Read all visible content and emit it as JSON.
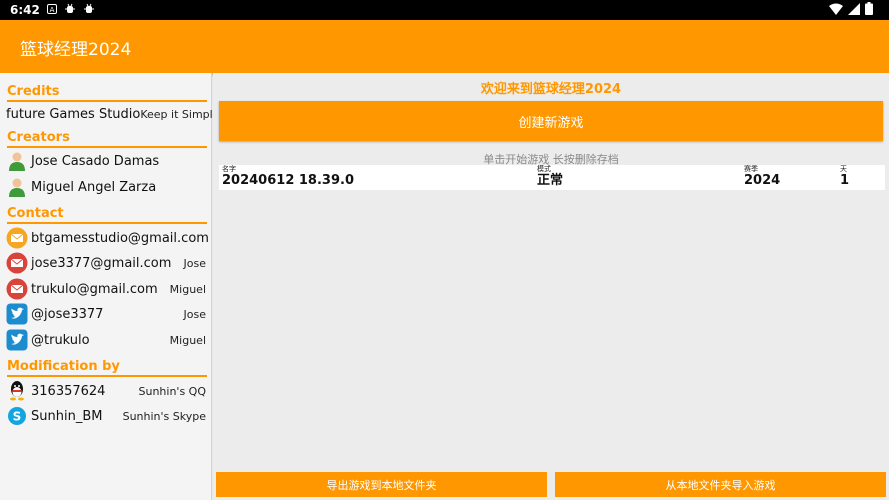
{
  "status_bar": {
    "time": "6:42",
    "icons": [
      "a-icon",
      "bug-icon",
      "bug-icon"
    ],
    "right_icons": [
      "wifi-icon",
      "signal-icon",
      "battery-icon"
    ]
  },
  "app_bar": {
    "title": "篮球经理2024"
  },
  "credits": {
    "header": "Credits",
    "studio": "future Games Studio",
    "slogan": "Keep it Simple"
  },
  "creators": {
    "header": "Creators",
    "people": [
      {
        "name": "Jose Casado Damas",
        "icon": "person-icon"
      },
      {
        "name": "Miguel Angel Zarza",
        "icon": "person-icon"
      }
    ]
  },
  "contact": {
    "header": "Contact",
    "items": [
      {
        "text": "btgamesstudio@gmail.com",
        "who": "",
        "icon": "mail-icon"
      },
      {
        "text": "jose3377@gmail.com",
        "who": "Jose",
        "icon": "mail-icon"
      },
      {
        "text": "trukulo@gmail.com",
        "who": "Miguel",
        "icon": "mail-icon"
      },
      {
        "text": "@jose3377",
        "who": "Jose",
        "icon": "twitter-icon"
      },
      {
        "text": "@trukulo",
        "who": "Miguel",
        "icon": "twitter-icon"
      }
    ]
  },
  "modification": {
    "header": "Modification by",
    "items": [
      {
        "text": "316357624",
        "who": "Sunhin's QQ",
        "icon": "qq-icon"
      },
      {
        "text": "Sunhin_BM",
        "who": "Sunhin's Skype",
        "icon": "skype-icon"
      }
    ]
  },
  "main": {
    "welcome": "欢迎来到篮球经理2024",
    "new_game_label": "创建新游戏",
    "hint": "单击开始游戏 长按删除存档",
    "save_slot": {
      "name_label": "名字",
      "name_value": "20240612 18.39.0",
      "mode_label": "模式",
      "mode_value": "正常",
      "season_label": "赛季",
      "season_value": "2024",
      "day_label": "天",
      "day_value": "1"
    },
    "export_label": "导出游戏到本地文件夹",
    "import_label": "从本地文件夹导入游戏"
  },
  "colors": {
    "accent": "#ff9800",
    "status_bar": "#000000"
  }
}
